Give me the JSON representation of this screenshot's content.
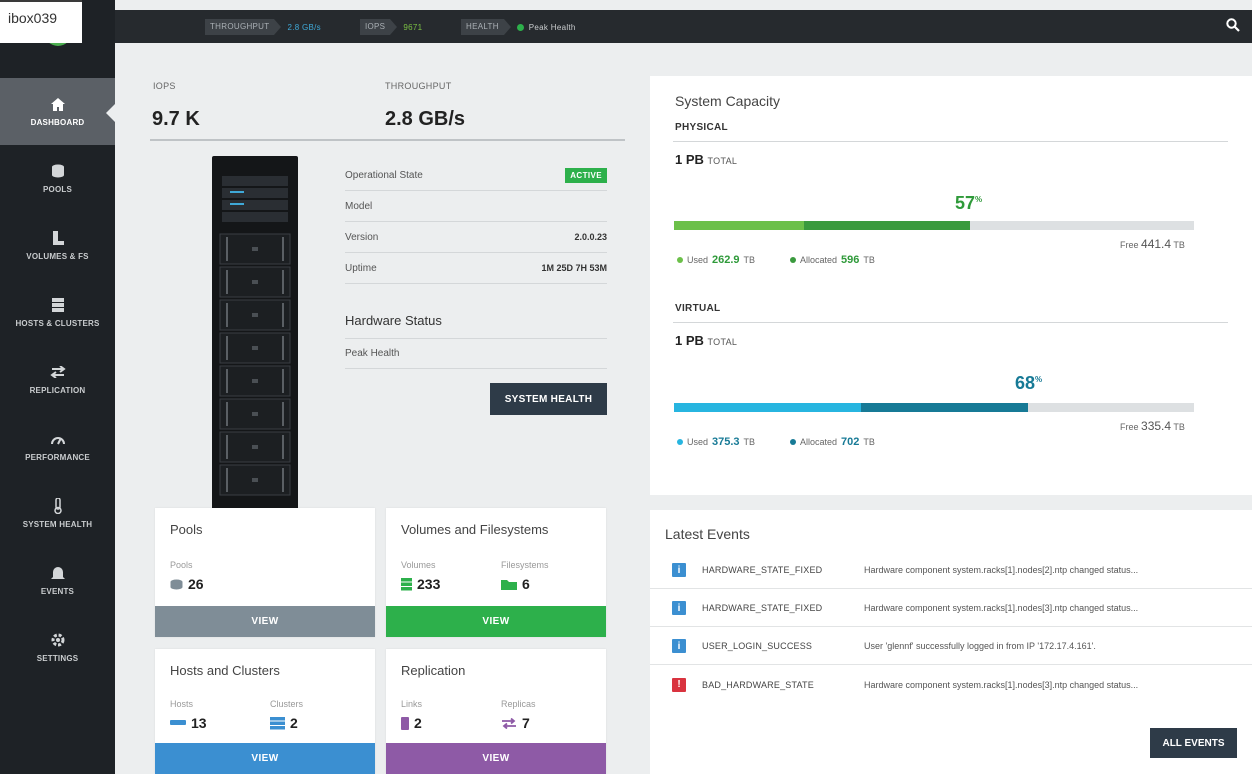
{
  "header": {
    "system_name": "ibox039",
    "throughput_label": "THROUGHPUT",
    "throughput_value": "2.8 GB/s",
    "iops_label": "IOPS",
    "iops_value": "9671",
    "health_label": "HEALTH",
    "health_value": "Peak Health",
    "colors": {
      "throughput": "#3fa9d8",
      "iops": "#7bc043",
      "health": "#2db04b"
    }
  },
  "sidebar": {
    "items": [
      {
        "label": "DASHBOARD",
        "icon": "home-icon",
        "active": true
      },
      {
        "label": "POOLS",
        "icon": "database-icon"
      },
      {
        "label": "VOLUMES & FS",
        "icon": "volumes-icon"
      },
      {
        "label": "HOSTS & CLUSTERS",
        "icon": "server-icon"
      },
      {
        "label": "REPLICATION",
        "icon": "replication-icon"
      },
      {
        "label": "PERFORMANCE",
        "icon": "gauge-icon"
      },
      {
        "label": "SYSTEM HEALTH",
        "icon": "thermometer-icon"
      },
      {
        "label": "EVENTS",
        "icon": "bell-icon"
      },
      {
        "label": "SETTINGS",
        "icon": "gear-icon"
      }
    ]
  },
  "kpis": {
    "iops_label": "IOPS",
    "iops_value": "9.7 K",
    "throughput_label": "THROUGHPUT",
    "throughput_value": "2.8 GB/s"
  },
  "system_info": {
    "operational_state_label": "Operational State",
    "operational_state_value": "ACTIVE",
    "model_label": "Model",
    "model_value": "",
    "version_label": "Version",
    "version_value": "2.0.0.23",
    "uptime_label": "Uptime",
    "uptime_value": "1M 25D 7H 53M",
    "hardware_status_title": "Hardware Status",
    "hardware_status_value": "Peak Health",
    "system_health_button": "SYSTEM HEALTH"
  },
  "cards": {
    "pools": {
      "title": "Pools",
      "sub1": "Pools",
      "val1": "26",
      "button": "VIEW",
      "color": "#7f8d97"
    },
    "volumes": {
      "title": "Volumes and Filesystems",
      "sub1": "Volumes",
      "val1": "233",
      "sub2": "Filesystems",
      "val2": "6",
      "button": "VIEW",
      "color": "#2db04b"
    },
    "hosts": {
      "title": "Hosts and Clusters",
      "sub1": "Hosts",
      "val1": "13",
      "sub2": "Clusters",
      "val2": "2",
      "button": "VIEW",
      "color": "#3b8fd1"
    },
    "replication": {
      "title": "Replication",
      "sub1": "Links",
      "val1": "2",
      "sub2": "Replicas",
      "val2": "7",
      "button": "VIEW",
      "color": "#8e5aa6"
    }
  },
  "capacity": {
    "title": "System Capacity",
    "physical": {
      "heading": "PHYSICAL",
      "total_value": "1 PB",
      "total_label": "TOTAL",
      "percent": "57",
      "percent_sign": "%",
      "used_fraction": 0.25,
      "allocated_fraction": 0.57,
      "used_label": "Used",
      "used_value": "262.9",
      "used_unit": "TB",
      "allocated_label": "Allocated",
      "allocated_value": "596",
      "allocated_unit": "TB",
      "free_label": "Free",
      "free_value": "441.4",
      "free_unit": "TB",
      "colors": {
        "used": "#6cc04a",
        "allocated": "#3a9a3e",
        "text": "#2f9a3a"
      }
    },
    "virtual": {
      "heading": "VIRTUAL",
      "total_value": "1 PB",
      "total_label": "TOTAL",
      "percent": "68",
      "percent_sign": "%",
      "used_fraction": 0.36,
      "allocated_fraction": 0.68,
      "used_label": "Used",
      "used_value": "375.3",
      "used_unit": "TB",
      "allocated_label": "Allocated",
      "allocated_value": "702",
      "allocated_unit": "TB",
      "free_label": "Free",
      "free_value": "335.4",
      "free_unit": "TB",
      "colors": {
        "used": "#27b5e0",
        "allocated": "#177a96",
        "text": "#177a96"
      }
    }
  },
  "events": {
    "title": "Latest Events",
    "rows": [
      {
        "type": "info",
        "name": "HARDWARE_STATE_FIXED",
        "desc": "Hardware component system.racks[1].nodes[2].ntp changed status..."
      },
      {
        "type": "info",
        "name": "HARDWARE_STATE_FIXED",
        "desc": "Hardware component system.racks[1].nodes[3].ntp changed status..."
      },
      {
        "type": "info",
        "name": "USER_LOGIN_SUCCESS",
        "desc": "User 'glennf' successfully logged in from IP '172.17.4.161'."
      },
      {
        "type": "error",
        "name": "BAD_HARDWARE_STATE",
        "desc": "Hardware component system.racks[1].nodes[3].ntp changed status..."
      }
    ],
    "all_events_button": "ALL EVENTS",
    "colors": {
      "info": "#3b8fd1",
      "error": "#d9333f"
    }
  }
}
